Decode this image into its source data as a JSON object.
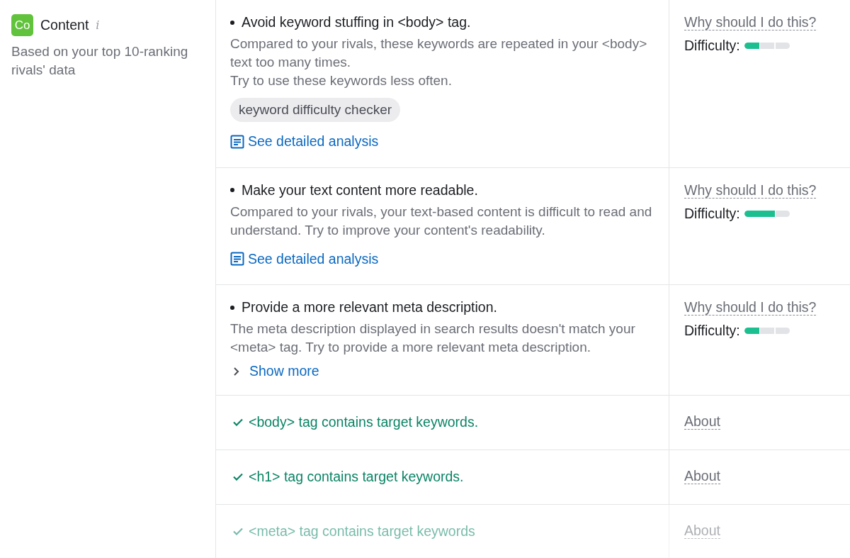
{
  "category": {
    "badge": "Co",
    "title": "Content",
    "info_icon": "i",
    "subtitle": "Based on your top 10-ranking rivals' data"
  },
  "items": [
    {
      "kind": "issue",
      "faded": false,
      "title": "Avoid keyword stuffing in <body> tag.",
      "paragraphs": [
        "Compared to your rivals, these keywords are repeated in your <body> text too many times.",
        "Try to use these keywords less often."
      ],
      "tags": [
        "keyword difficulty checker"
      ],
      "link": "See detailed analysis",
      "help": "Why should I do this?",
      "difficulty_label": "Difficulty:",
      "level": 0.33
    },
    {
      "kind": "issue",
      "faded": false,
      "title": "Make your text content more readable.",
      "paragraphs": [
        "Compared to your rivals, your text-based content is difficult to read and understand. Try to improve your content's readability."
      ],
      "link": "See detailed analysis",
      "help": "Why should I do this?",
      "difficulty_label": "Difficulty:",
      "level": 0.67
    },
    {
      "kind": "issue",
      "faded": false,
      "title": "Provide a more relevant meta description.",
      "paragraphs": [
        "The meta description displayed in search results doesn't match your <meta> tag. Try to provide a more relevant meta description."
      ],
      "show_more": {
        "label": "Show more",
        "expanded": false
      },
      "help": "Why should I do this?",
      "difficulty_label": "Difficulty:",
      "level": 0.33
    },
    {
      "kind": "passed",
      "faded": false,
      "title": "<body> tag contains target keywords.",
      "help": "About"
    },
    {
      "kind": "passed",
      "faded": false,
      "title": "<h1> tag contains target keywords.",
      "help": "About"
    },
    {
      "kind": "passed",
      "faded": true,
      "title": "<meta> tag contains target keywords",
      "help": "About"
    }
  ]
}
